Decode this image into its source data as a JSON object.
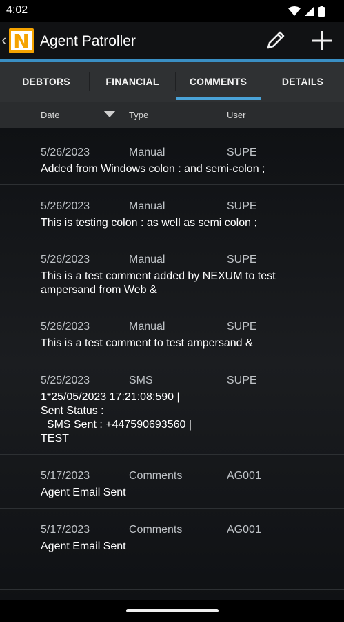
{
  "status_bar": {
    "time": "4:02",
    "icons": [
      "wifi-icon",
      "signal-icon",
      "battery-icon"
    ]
  },
  "app_bar": {
    "title": "Agent Patroller",
    "logo_letter": "N",
    "actions": [
      "pencil-icon",
      "plus-icon"
    ]
  },
  "tabs": [
    {
      "label": "DEBTORS"
    },
    {
      "label": "FINANCIAL"
    },
    {
      "label": "COMMENTS",
      "selected": true
    },
    {
      "label": "DETAILS"
    }
  ],
  "columns": {
    "date": "Date",
    "type": "Type",
    "user": "User"
  },
  "comments": [
    {
      "date": "5/26/2023",
      "type": "Manual",
      "user": "SUPE",
      "text": "Added from Windows colon : and semi-colon ;"
    },
    {
      "date": "5/26/2023",
      "type": "Manual",
      "user": "SUPE",
      "text": "This is testing colon : as well as semi colon ;"
    },
    {
      "date": "5/26/2023",
      "type": "Manual",
      "user": "SUPE",
      "text": "This is a test comment added by NEXUM to test\nampersand from Web &"
    },
    {
      "date": "5/26/2023",
      "type": "Manual",
      "user": "SUPE",
      "text": "This is a test comment to test ampersand &"
    },
    {
      "date": "5/25/2023",
      "type": "SMS",
      "user": "SUPE",
      "text": "1*25/05/2023 17:21:08:590 |\nSent Status :\n  SMS Sent : +447590693560 |\nTEST"
    },
    {
      "date": "5/17/2023",
      "type": "Comments",
      "user": "AG001",
      "text": "Agent Email Sent"
    },
    {
      "date": "5/17/2023",
      "type": "Comments",
      "user": "AG001",
      "text": "Agent Email Sent"
    }
  ],
  "colors": {
    "accent": "#4aa3d8",
    "logo": "#f5a300"
  }
}
